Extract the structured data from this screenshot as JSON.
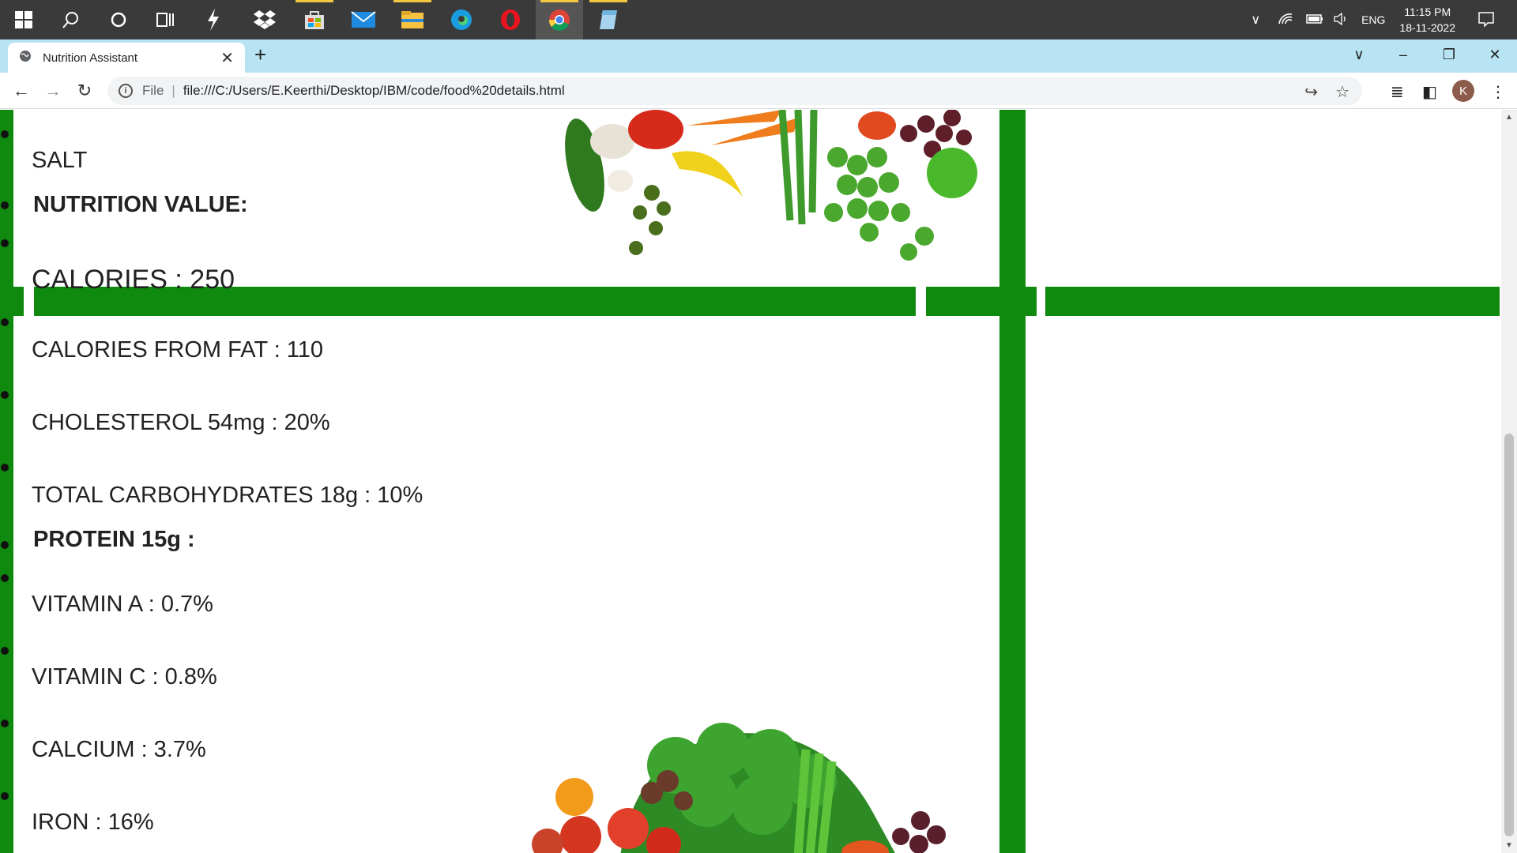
{
  "taskbar": {
    "tray": {
      "language": "ENG",
      "time": "11:15 PM",
      "date": "18-11-2022"
    }
  },
  "browser": {
    "tab_title": "Nutrition Assistant",
    "address": {
      "scheme_label": "File",
      "url": "file:///C:/Users/E.Keerthi/Desktop/IBM/code/food%20details.html"
    },
    "profile_initial": "K"
  },
  "page": {
    "salt": "SALT",
    "nutrition_heading": "NUTRITION VALUE:",
    "calories": "CALORIES : 250",
    "calories_from_fat": "CALORIES FROM FAT : 110",
    "cholesterol": "CHOLESTEROL 54mg : 20%",
    "carbohydrates": "TOTAL CARBOHYDRATES 18g : 10%",
    "protein_heading": "PROTEIN 15g :",
    "vitamin_a": "VITAMIN A : 0.7%",
    "vitamin_c": "VITAMIN C : 0.8%",
    "calcium": "CALCIUM : 3.7%",
    "iron": "IRON : 16%"
  },
  "colors": {
    "accent_green": "#0f8a0f",
    "tab_strip": "#b7e3f2",
    "taskbar": "#3a3a3a"
  }
}
